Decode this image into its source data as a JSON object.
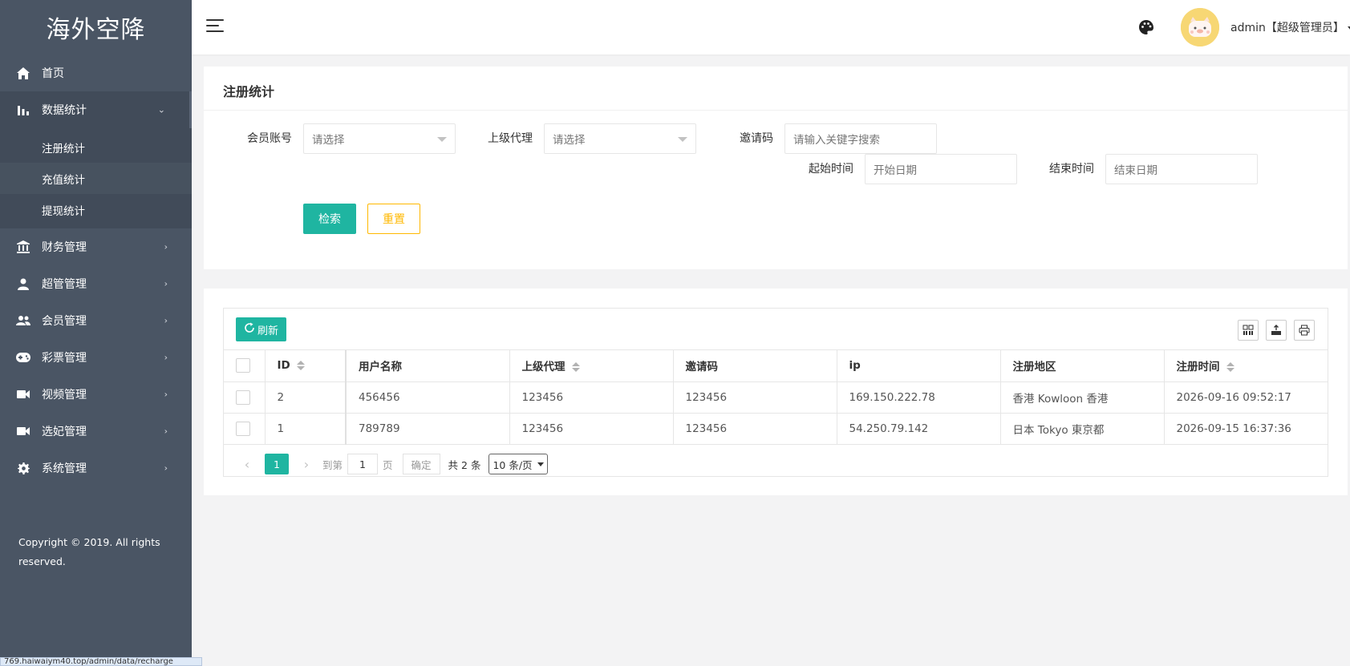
{
  "app": {
    "title": "海外空降"
  },
  "sidebar": {
    "items": [
      {
        "label": "首页",
        "icon": "home-icon"
      },
      {
        "label": "数据统计",
        "icon": "bar-chart-icon",
        "open": true,
        "children": [
          "注册统计",
          "充值统计",
          "提现统计"
        ]
      },
      {
        "label": "财务管理",
        "icon": "bank-icon"
      },
      {
        "label": "超管管理",
        "icon": "user-icon"
      },
      {
        "label": "会员管理",
        "icon": "users-icon"
      },
      {
        "label": "彩票管理",
        "icon": "gamepad-icon"
      },
      {
        "label": "视频管理",
        "icon": "video-icon"
      },
      {
        "label": "选妃管理",
        "icon": "video-icon"
      },
      {
        "label": "系统管理",
        "icon": "gear-icon"
      }
    ],
    "copyright": "Copyright © 2019. All rights reserved."
  },
  "header": {
    "user": "admin【超级管理员】"
  },
  "search": {
    "title": "注册统计",
    "fields": {
      "member": {
        "label": "会员账号",
        "placeholder": "请选择"
      },
      "agent": {
        "label": "上级代理",
        "placeholder": "请选择"
      },
      "invite": {
        "label": "邀请码",
        "placeholder": "请输入关键字搜索"
      },
      "start": {
        "label": "起始时间",
        "placeholder": "开始日期"
      },
      "end": {
        "label": "结束时间",
        "placeholder": "结束日期"
      }
    },
    "search_label": "检索",
    "reset_label": "重置"
  },
  "table": {
    "refresh_label": "刷新",
    "columns": [
      "ID",
      "用户名称",
      "上级代理",
      "邀请码",
      "ip",
      "注册地区",
      "注册时间"
    ],
    "rows": [
      [
        "2",
        "456456",
        "123456",
        "123456",
        "169.150.222.78",
        "香港 Kowloon 香港",
        "2026-09-16 09:52:17"
      ],
      [
        "1",
        "789789",
        "123456",
        "123456",
        "54.250.79.142",
        "日本 Tokyo 東京都",
        "2026-09-15 16:37:36"
      ]
    ]
  },
  "pager": {
    "current": "1",
    "goto": "到第",
    "page_input": "1",
    "page_unit": "页",
    "ok": "确定",
    "total": "共 2 条",
    "size": "10 条/页"
  },
  "status_url": "769.haiwaiym40.top/admin/data/recharge",
  "colors": {
    "accent": "#1fb5a1",
    "warning": "#ffb800",
    "sidebar": "#4a5564"
  }
}
